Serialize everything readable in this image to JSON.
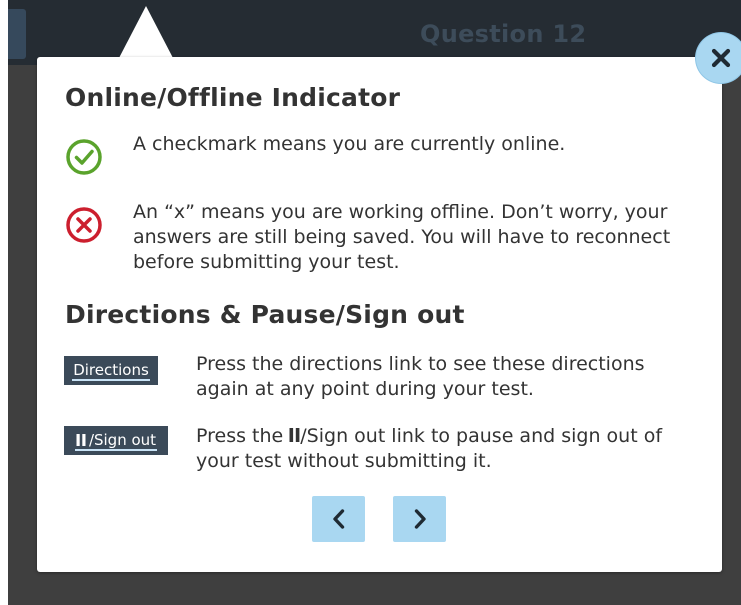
{
  "header": {
    "question_label": "Question 12"
  },
  "dialog": {
    "section1_title": "Online/Offline Indicator",
    "online_text": "A checkmark means you are currently online.",
    "offline_text": "An “x” means you are working offline. Don’t worry, your answers are still being saved. You will have to reconnect before submitting your test.",
    "section2_title": "Directions & Pause/Sign out",
    "directions_chip_label": "Directions",
    "directions_text": "Press the directions link to see these directions again at any point during your test.",
    "signout_chip_label": "/Sign out",
    "pause_text_prefix": "Press the ",
    "pause_text_suffix": "/Sign out link to pause and sign out of your test without submitting it."
  },
  "icons": {
    "online": "check-circle-icon",
    "offline": "x-circle-icon",
    "pause": "pause-icon",
    "close": "close-icon",
    "prev": "chevron-left-icon",
    "next": "chevron-right-icon"
  },
  "colors": {
    "online_green": "#5aa32c",
    "offline_red": "#cc1f2e",
    "chip_bg": "#3b4a59",
    "accent_blue": "#a9d7f1",
    "topbar": "#252c33"
  }
}
